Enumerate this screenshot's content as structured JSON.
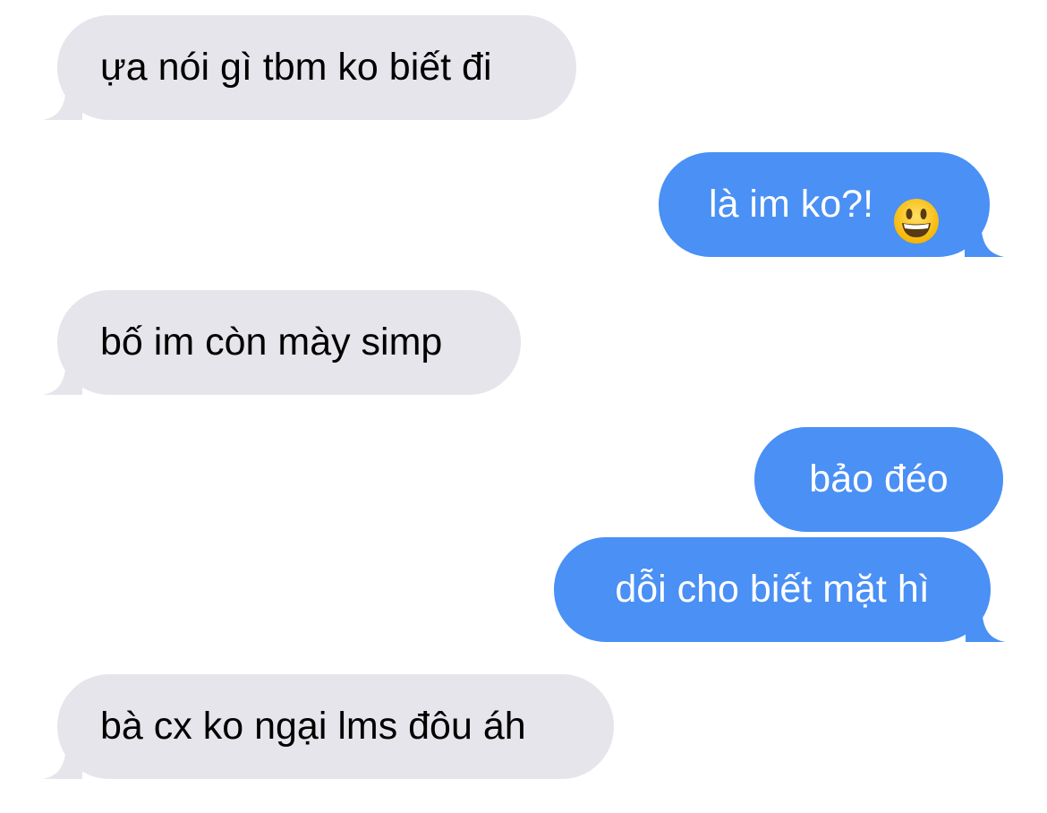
{
  "conversation": {
    "messages": [
      {
        "direction": "received",
        "text": "ựa nói gì tbm ko biết đi"
      },
      {
        "direction": "sent",
        "text": "là im ko?! ",
        "emoji": "grinning-face-emoji"
      },
      {
        "direction": "received",
        "text": "bố im còn mày simp"
      },
      {
        "direction": "sent",
        "text": "bảo đéo"
      },
      {
        "direction": "sent",
        "text": "dỗi cho biết mặt hì"
      },
      {
        "direction": "received",
        "text": "bà cx ko ngại lms đôu áh"
      }
    ]
  },
  "colors": {
    "received_bubble": "#e6e5eb",
    "sent_bubble": "#4a90f5",
    "background": "#ffffff"
  }
}
